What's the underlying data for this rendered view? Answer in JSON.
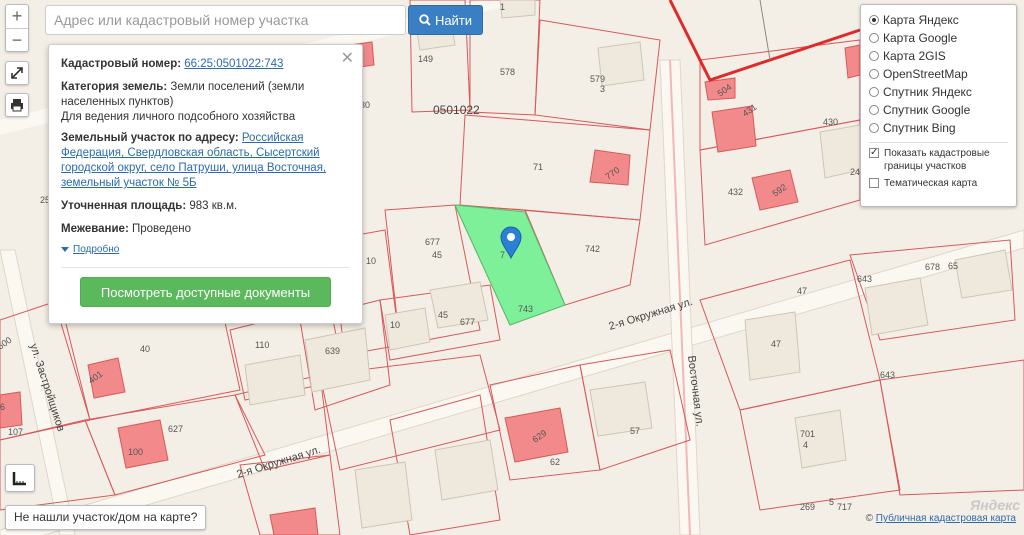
{
  "search": {
    "placeholder": "Адрес или кадастровый номер участка",
    "button_label": "Найти"
  },
  "zoom": {
    "in_label": "+",
    "out_label": "−"
  },
  "popup": {
    "cadastral_number_label": "Кадастровый номер:",
    "cadastral_number_value": "66:25:0501022:743",
    "land_category_label": "Категория земель:",
    "land_category_value": "Земли поселений (земли населенных пунктов)",
    "land_use_text": "Для ведения личного подсобного хозяйства",
    "address_label": "Земельный участок по адресу:",
    "address_value": "Российская Федерация, Свердловская область, Сысертский городской округ, село Патруши, улица Восточная, земельный участок № 5Б",
    "area_label": "Уточненная площадь:",
    "area_value": "983 кв.м.",
    "survey_label": "Межевание:",
    "survey_value": "Проведено",
    "more_link": "Подробно",
    "docs_button": "Посмотреть доступные документы",
    "close_symbol": "✕"
  },
  "layers": {
    "options": [
      {
        "label": "Карта Яндекс",
        "selected": true
      },
      {
        "label": "Карта Google",
        "selected": false
      },
      {
        "label": "Карта 2GIS",
        "selected": false
      },
      {
        "label": "OpenStreetMap",
        "selected": false
      },
      {
        "label": "Спутник Яндекс",
        "selected": false
      },
      {
        "label": "Спутник Google",
        "selected": false
      },
      {
        "label": "Спутник Bing",
        "selected": false
      }
    ],
    "toggles": [
      {
        "label": "Показать кадастровые границы участков",
        "checked": true
      },
      {
        "label": "Тематическая карта",
        "checked": false
      }
    ]
  },
  "map": {
    "quarter_label": "0501022",
    "streets": {
      "okruzhnaya_upper": "2-я Окружная ул.",
      "okruzhnaya_lower": "2-я Окружная ул.",
      "vostochnaya": "Восточная ул.",
      "zastroyshchikov": "ул. Застройщиков"
    },
    "parcel_labels": [
      "1",
      "149",
      "578",
      "579",
      "3",
      "71",
      "770",
      "504",
      "431",
      "430",
      "24",
      "432",
      "592",
      "25",
      "677",
      "45",
      "742",
      "743",
      "10",
      "10",
      "45",
      "677",
      "40",
      "110",
      "639",
      "7",
      "643",
      "678",
      "65",
      "47",
      "47",
      "643",
      "701",
      "4",
      "627",
      "629",
      "62",
      "57",
      "100",
      "107",
      "269",
      "717",
      "5",
      "30",
      "401",
      "600",
      "6"
    ],
    "selected_parcel": "743",
    "yandex_logo": "Яндекс"
  },
  "feedback_label": "Не нашли участок/дом на карте?",
  "attribution": {
    "prefix": "©",
    "link": "Публичная кадастровая карта"
  },
  "colors": {
    "background": "#f4efe6",
    "parcel_border": "#d8585a",
    "building": "#f28a8c",
    "selected_parcel": "#7ef09a",
    "search_button": "#3a7fc4",
    "docs_button": "#5cb85c",
    "marker": "#2a80d4",
    "boundary_line": "#e02a2a"
  }
}
